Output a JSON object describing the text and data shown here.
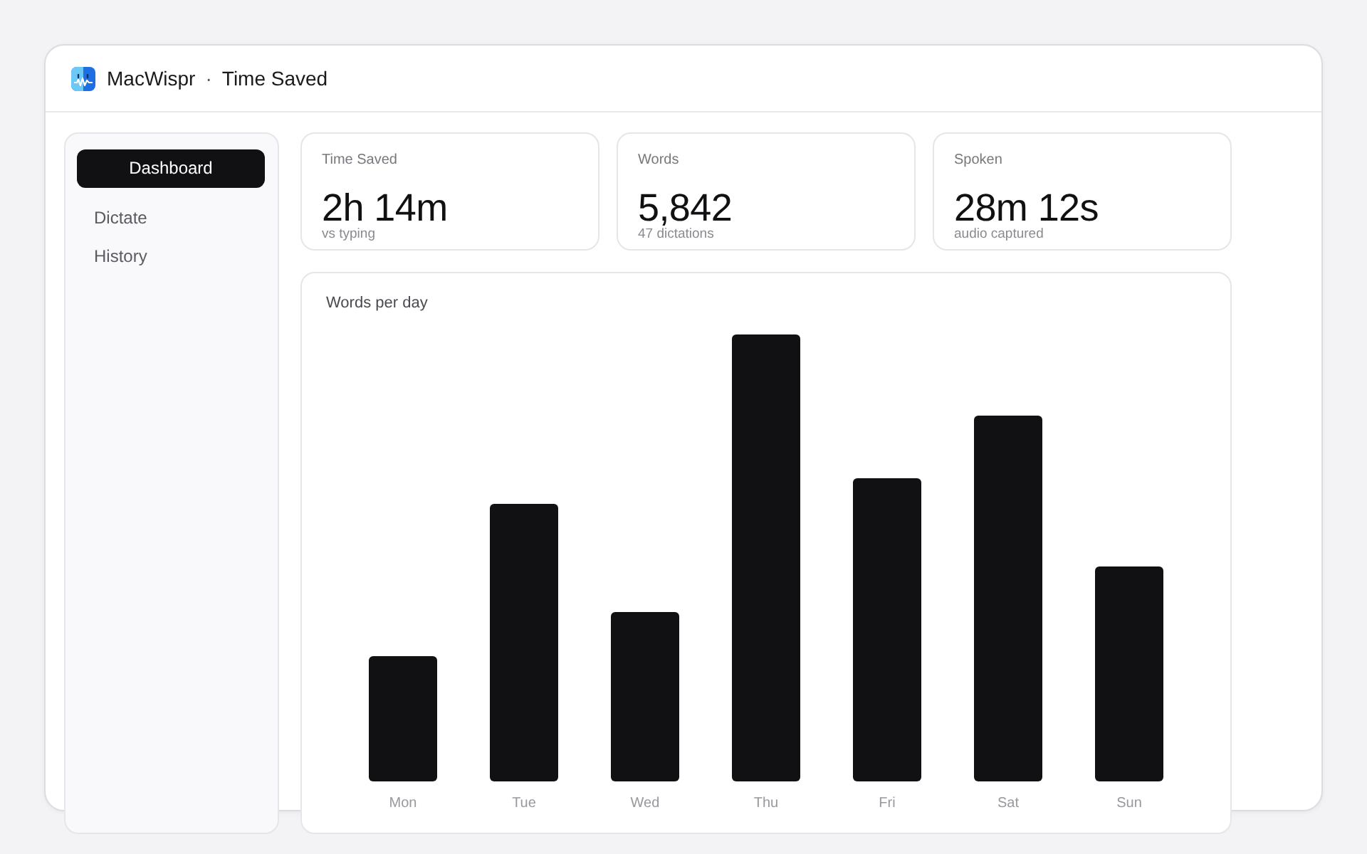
{
  "window": {
    "app_name": "MacWispr",
    "separator": "·",
    "title": "Time Saved"
  },
  "sidebar": {
    "items": [
      {
        "label": "Dashboard",
        "selected": true
      },
      {
        "label": "Dictate",
        "selected": false
      },
      {
        "label": "History",
        "selected": false
      }
    ]
  },
  "stats": [
    {
      "label": "Time Saved",
      "value": "2h 14m",
      "caption": "vs typing"
    },
    {
      "label": "Words",
      "value": "5,842",
      "caption": "47 dictations"
    },
    {
      "label": "Spoken",
      "value": "28m 12s",
      "caption": "audio captured"
    }
  ],
  "chart": {
    "title": "Words per day",
    "categories": [
      "Mon",
      "Tue",
      "Wed",
      "Thu",
      "Fri",
      "Sat",
      "Sun"
    ]
  }
}
